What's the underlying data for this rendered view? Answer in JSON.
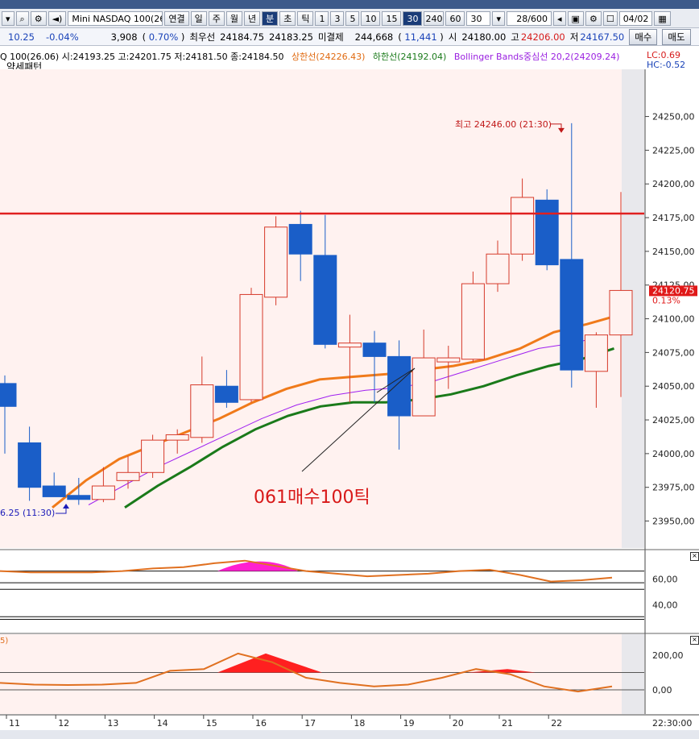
{
  "toolbar": {
    "symbol": "Mini NASDAQ 100(26.0",
    "buttons": [
      "연결",
      "일",
      "주",
      "월",
      "년",
      "분",
      "초",
      "틱"
    ],
    "selected_unit": "분",
    "periods": [
      "1",
      "3",
      "5",
      "10",
      "15",
      "30",
      "240",
      "60"
    ],
    "selected_period": "30",
    "count_value": "30",
    "paging": "28/600",
    "date": "04/02"
  },
  "quote": {
    "change": "10.25",
    "change_pct": "-0.04%",
    "volume_change": "3,908",
    "volume_pct": "0.70%",
    "best_bid_label": "최우선",
    "best_bid": "24184.75",
    "best_ask": "24183.25",
    "open_interest_label": "미결제",
    "open_interest": "244,668",
    "oi_change": "11,441",
    "open_label": "시",
    "open": "24180.00",
    "high_label": "고",
    "high": "24206.00",
    "low_label": "저",
    "low": "24167.50",
    "buy_label": "매수",
    "sell_label": "매도"
  },
  "legend": {
    "ohlc": "Q 100(26.06) 시:24193.25 고:24201.75 저:24181.50 종:24184.50",
    "upper": "상한선(24226.43)",
    "lower": "하한선(24192.04)",
    "middle": "Bollinger Bands중심선 20,2(24209.24)",
    "pattern": "약세패턴",
    "lc": "LC:0.69",
    "hc": "HC:-0.52"
  },
  "colors": {
    "up": "#d63a2a",
    "down": "#1a5ec8",
    "upper_band": "#f07a1a",
    "lower_band": "#1a7a1a",
    "middle_band": "#a020f0",
    "resistance": "#e02020",
    "bg": "#fff2f0"
  },
  "chart_data": [
    {
      "type": "candlestick",
      "yticks": [
        23950,
        23975,
        24000,
        24025,
        24050,
        24075,
        24100,
        24125,
        24150,
        24175,
        24200,
        24225,
        24250
      ],
      "ylim": [
        23930,
        24285
      ],
      "x_labels": [
        "11",
        "12",
        "13",
        "14",
        "15",
        "16",
        "17",
        "18",
        "19",
        "20",
        "21",
        "22"
      ],
      "time_label": "22:30:00",
      "candles": [
        {
          "o": 24052,
          "h": 24058,
          "l": 24000,
          "c": 24035
        },
        {
          "o": 24008,
          "h": 24020,
          "l": 23965,
          "c": 23975
        },
        {
          "o": 23976,
          "h": 23986,
          "l": 23970,
          "c": 23968
        },
        {
          "o": 23969,
          "h": 23982,
          "l": 23962,
          "c": 23966
        },
        {
          "o": 23966,
          "h": 23990,
          "l": 23964,
          "c": 23976
        },
        {
          "o": 23980,
          "h": 23998,
          "l": 23974,
          "c": 23986
        },
        {
          "o": 23986,
          "h": 24014,
          "l": 23982,
          "c": 24010
        },
        {
          "o": 24010,
          "h": 24018,
          "l": 24000,
          "c": 24014
        },
        {
          "o": 24012,
          "h": 24072,
          "l": 24008,
          "c": 24051
        },
        {
          "o": 24050,
          "h": 24062,
          "l": 24034,
          "c": 24038
        },
        {
          "o": 24040,
          "h": 24123,
          "l": 24038,
          "c": 24118
        },
        {
          "o": 24116,
          "h": 24176,
          "l": 24110,
          "c": 24168
        },
        {
          "o": 24170,
          "h": 24180,
          "l": 24128,
          "c": 24148
        },
        {
          "o": 24147,
          "h": 24177,
          "l": 24078,
          "c": 24081
        },
        {
          "o": 24079,
          "h": 24103,
          "l": 24038,
          "c": 24082
        },
        {
          "o": 24082,
          "h": 24091,
          "l": 24038,
          "c": 24072
        },
        {
          "o": 24072,
          "h": 24084,
          "l": 24003,
          "c": 24028
        },
        {
          "o": 24028,
          "h": 24092,
          "l": 24028,
          "c": 24071
        },
        {
          "o": 24068,
          "h": 24080,
          "l": 24048,
          "c": 24071
        },
        {
          "o": 24070,
          "h": 24135,
          "l": 24068,
          "c": 24126
        },
        {
          "o": 24126,
          "h": 24158,
          "l": 24120,
          "c": 24148
        },
        {
          "o": 24148,
          "h": 24204,
          "l": 24143,
          "c": 24190
        },
        {
          "o": 24188,
          "h": 24196,
          "l": 24136,
          "c": 24140
        },
        {
          "o": 24144,
          "h": 24245,
          "l": 24049,
          "c": 24062
        },
        {
          "o": 24061,
          "h": 24090,
          "l": 24034,
          "c": 24088
        },
        {
          "o": 24088,
          "h": 24194,
          "l": 24042,
          "c": 24121
        }
      ],
      "upper_band": [
        23960,
        23980,
        23996,
        24006,
        24016,
        24026,
        24038,
        24048,
        24055,
        24057,
        24059,
        24062,
        24065,
        24070,
        24078,
        24090,
        24096,
        24103
      ],
      "middle_band": [
        23962,
        23976,
        23990,
        24002,
        24014,
        24026,
        24036,
        24043,
        24047,
        24049,
        24054,
        24062,
        24070,
        24078,
        24082,
        24088
      ],
      "lower_band": [
        23960,
        23976,
        23990,
        24005,
        24018,
        24028,
        24035,
        24038,
        24038,
        24040,
        24044,
        24050,
        24058,
        24065,
        24070,
        24078
      ],
      "resistance_level": 24178,
      "price_tag": "24120.75",
      "price_tag_pct": "0.13%",
      "high_annotation": "최고 24246.00 (21:30)",
      "low_annotation": "6.25 (11:30)",
      "trade_annotation": "061매수100틱"
    },
    {
      "type": "line",
      "name": "oscillator",
      "yticks": [
        40,
        60
      ],
      "values": [
        66,
        65,
        65,
        65,
        66,
        68,
        69,
        72,
        74,
        70,
        66,
        64,
        62,
        63,
        64,
        66,
        67,
        63,
        58,
        59,
        61
      ]
    },
    {
      "type": "area",
      "name": "momentum",
      "label": "5)",
      "yticks": [
        0,
        200
      ],
      "values": [
        40,
        30,
        28,
        30,
        40,
        110,
        120,
        210,
        160,
        70,
        40,
        20,
        30,
        70,
        120,
        90,
        20,
        -10,
        20
      ]
    }
  ]
}
